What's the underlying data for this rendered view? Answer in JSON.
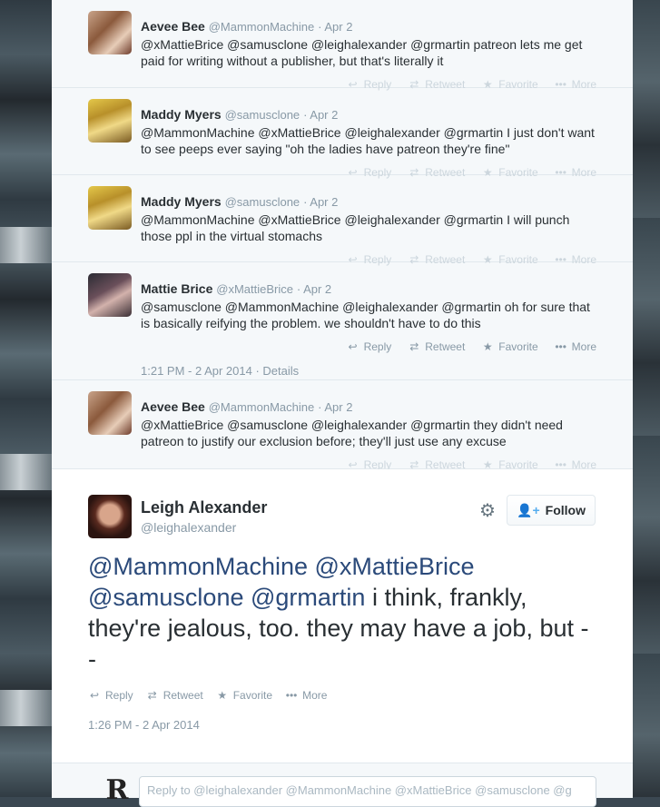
{
  "thread": [
    {
      "name": "Aevee Bee",
      "handle": "@MammonMachine",
      "time": "· Apr 2",
      "text": "@xMattieBrice @samusclone @leighalexander @grmartin patreon lets me get paid for writing without a publisher, but that's literally it",
      "faded": true
    },
    {
      "name": "Maddy Myers",
      "handle": "@samusclone",
      "time": "· Apr 2",
      "text": "@MammonMachine @xMattieBrice @leighalexander @grmartin I just don't want to see peeps ever saying \"oh the ladies have patreon they're fine\"",
      "faded": true
    },
    {
      "name": "Maddy Myers",
      "handle": "@samusclone",
      "time": "· Apr 2",
      "text": "@MammonMachine @xMattieBrice @leighalexander @grmartin I will punch those ppl in the virtual stomachs",
      "faded": true
    },
    {
      "name": "Mattie Brice",
      "handle": "@xMattieBrice",
      "time": "· Apr 2",
      "text": "@samusclone @MammonMachine @leighalexander @grmartin oh for sure that is basically reifying the problem. we shouldn't have to do this",
      "faded": false,
      "stamp": "1:21 PM - 2 Apr 2014 · Details"
    },
    {
      "name": "Aevee Bee",
      "handle": "@MammonMachine",
      "time": "· Apr 2",
      "text": "@xMattieBrice @samusclone @leighalexander @grmartin they didn't need patreon to justify our exclusion before; they'll just use any excuse",
      "faded": true
    }
  ],
  "actions": {
    "reply": "Reply",
    "retweet": "Retweet",
    "favorite": "Favorite",
    "more": "More"
  },
  "main": {
    "name": "Leigh Alexander",
    "handle": "@leighalexander",
    "follow_label": "Follow",
    "mentions": [
      "@MammonMachine",
      "@xMattieBrice",
      "@samusclone",
      "@grmartin"
    ],
    "body": "i think, frankly, they're jealous, too. they may have a job, but --",
    "stamp": "1:26 PM - 2 Apr 2014"
  },
  "reply_box": {
    "placeholder": "Reply to @leighalexander @MammonMachine @xMattieBrice @samusclone @g"
  },
  "colors": {
    "link": "#2b4a7a",
    "accent": "#55acee",
    "muted": "#8899a6",
    "faded": "#ccd6dd"
  },
  "icons": {
    "reply": "reply-icon",
    "retweet": "retweet-icon",
    "favorite": "star-icon",
    "more": "more-icon",
    "gear": "gear-icon",
    "follow": "follow-person-icon"
  }
}
